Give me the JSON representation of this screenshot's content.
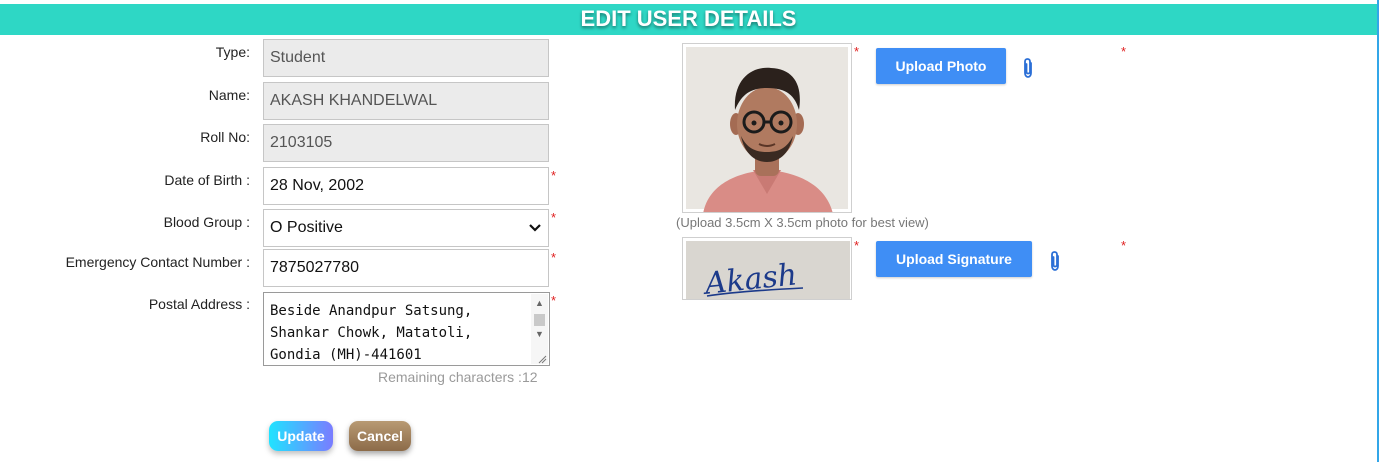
{
  "header": {
    "title": "EDIT USER DETAILS"
  },
  "form": {
    "type": {
      "label": "Type:",
      "value": "Student"
    },
    "name": {
      "label": "Name:",
      "value": "AKASH KHANDELWAL"
    },
    "roll_no": {
      "label": "Roll No:",
      "value": "2103105"
    },
    "dob": {
      "label": "Date of Birth :",
      "value": "28 Nov, 2002"
    },
    "blood_group": {
      "label": "Blood Group :",
      "value": "O Positive"
    },
    "emergency": {
      "label": "Emergency Contact Number :",
      "value": "7875027780"
    },
    "address": {
      "label": "Postal Address :",
      "value": "Beside Anandpur Satsung,\nShankar Chowk, Matatoli,\nGondia (MH)-441601",
      "remaining": "Remaining characters :12"
    },
    "required_mark": "*"
  },
  "actions": {
    "update": "Update",
    "cancel": "Cancel"
  },
  "uploads": {
    "photo_hint": "(Upload 3.5cm X 3.5cm photo for best view)",
    "upload_photo": "Upload Photo",
    "upload_signature": "Upload Signature",
    "signature_text": "Akash"
  },
  "colors": {
    "header_bg": "#2ed7c5",
    "upload_button": "#3f8ef5",
    "required": "#e02020",
    "update_gradient": [
      "#20e3ff",
      "#7a7cff"
    ],
    "cancel_gradient": [
      "#b89a73",
      "#8c6b49"
    ]
  },
  "icons": {
    "attachment": "paperclip-icon",
    "select_arrow": "chevron-down-icon",
    "scroll_up": "scroll-up-arrow-icon",
    "scroll_down": "scroll-down-arrow-icon",
    "resize": "resize-grip-icon"
  }
}
